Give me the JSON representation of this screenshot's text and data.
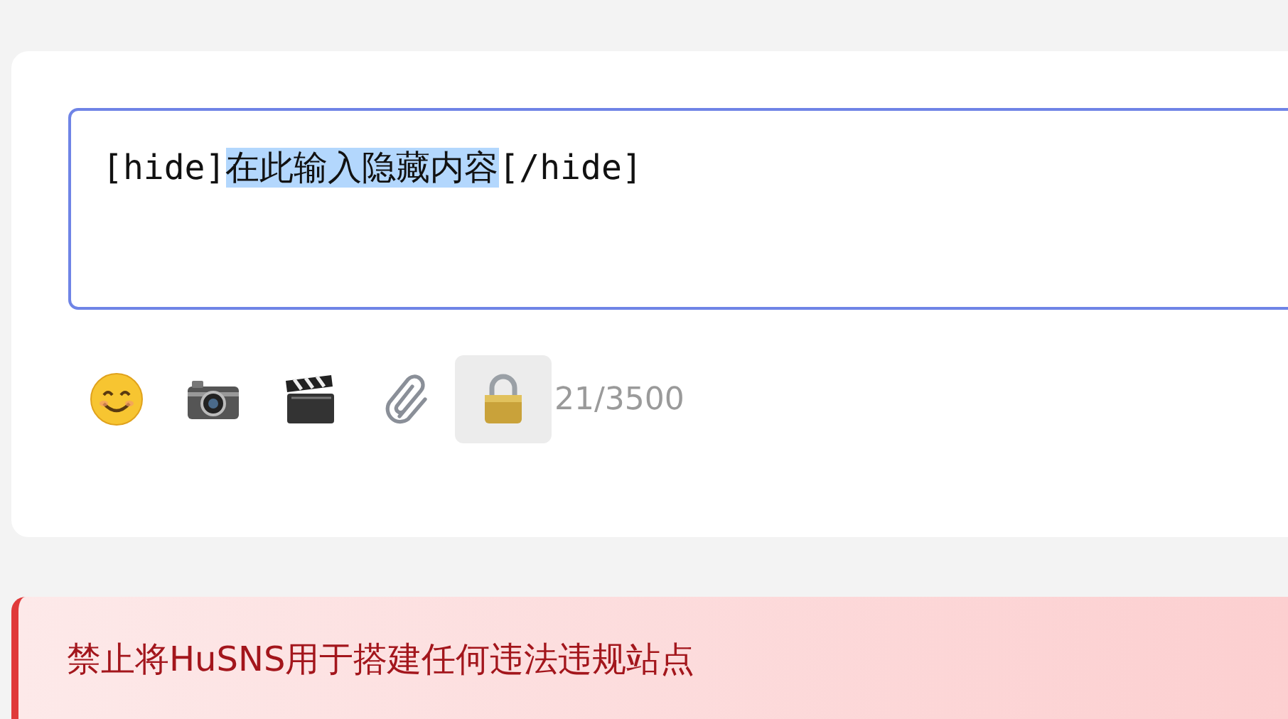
{
  "editor": {
    "value_parts": [
      {
        "text": "[hide]",
        "selected": false
      },
      {
        "text": "在此输入隐藏内容",
        "selected": true
      },
      {
        "text": "[/hide]",
        "selected": false
      }
    ]
  },
  "toolbar": {
    "buttons": [
      {
        "kind": "emoji",
        "selected": false
      },
      {
        "kind": "camera",
        "selected": false
      },
      {
        "kind": "video",
        "selected": false
      },
      {
        "kind": "attachment",
        "selected": false
      },
      {
        "kind": "lock",
        "selected": true
      }
    ],
    "counter": "21/3500"
  },
  "notice": {
    "text": "禁止将HuSNS用于搭建任何违法违规站点"
  }
}
